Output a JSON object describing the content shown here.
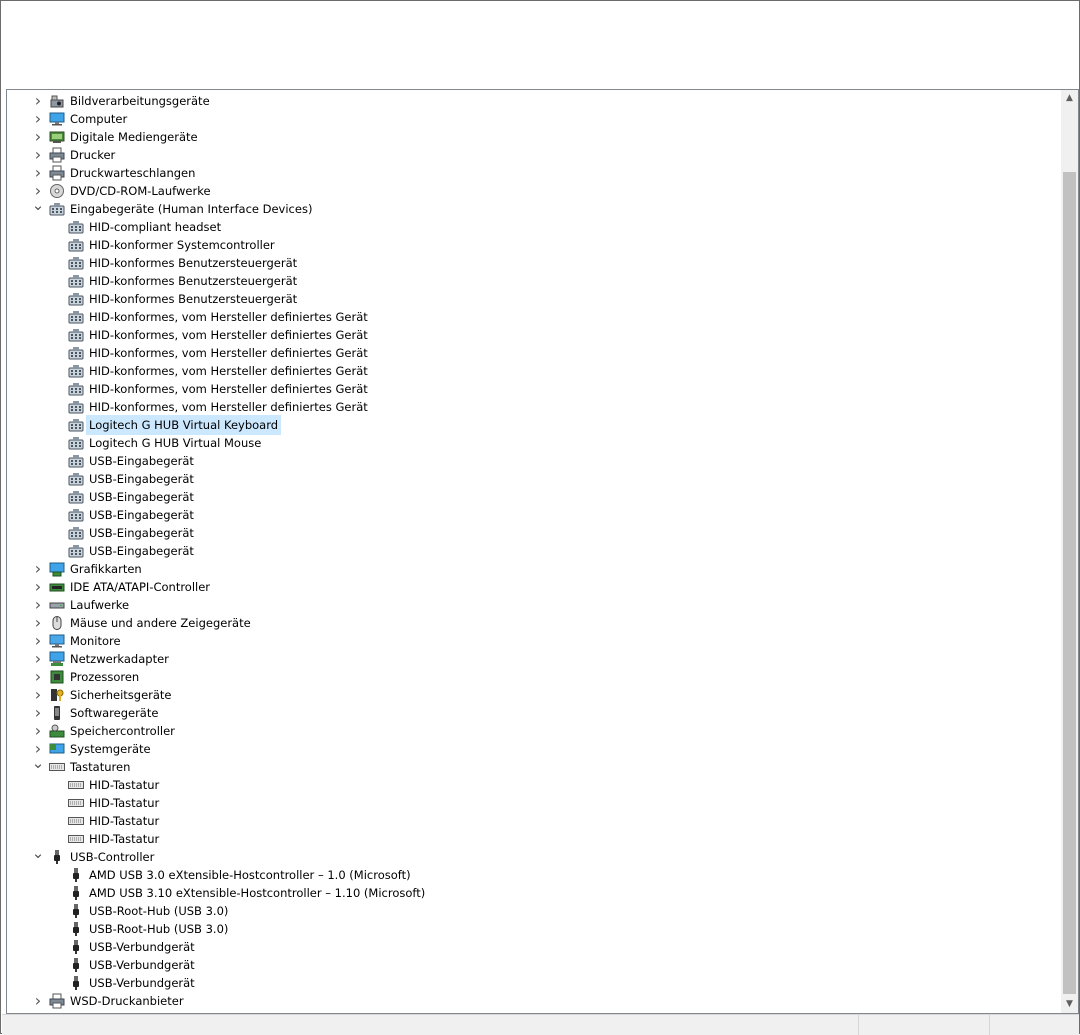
{
  "tree": [
    {
      "label": "Bildverarbeitungsgeräte",
      "level": 0,
      "expander": "collapsed",
      "icon": "camera-scanner-icon"
    },
    {
      "label": "Computer",
      "level": 0,
      "expander": "collapsed",
      "icon": "computer-icon"
    },
    {
      "label": "Digitale Mediengeräte",
      "level": 0,
      "expander": "collapsed",
      "icon": "media-device-icon"
    },
    {
      "label": "Drucker",
      "level": 0,
      "expander": "collapsed",
      "icon": "printer-icon"
    },
    {
      "label": "Druckwarteschlangen",
      "level": 0,
      "expander": "collapsed",
      "icon": "printer-icon"
    },
    {
      "label": "DVD/CD-ROM-Laufwerke",
      "level": 0,
      "expander": "collapsed",
      "icon": "disc-drive-icon"
    },
    {
      "label": "Eingabegeräte (Human Interface Devices)",
      "level": 0,
      "expander": "expanded",
      "icon": "hid-icon"
    },
    {
      "label": "HID-compliant headset",
      "level": 1,
      "icon": "hid-icon"
    },
    {
      "label": "HID-konformer Systemcontroller",
      "level": 1,
      "icon": "hid-icon"
    },
    {
      "label": "HID-konformes Benutzersteuergerät",
      "level": 1,
      "icon": "hid-icon"
    },
    {
      "label": "HID-konformes Benutzersteuergerät",
      "level": 1,
      "icon": "hid-icon"
    },
    {
      "label": "HID-konformes Benutzersteuergerät",
      "level": 1,
      "icon": "hid-icon"
    },
    {
      "label": "HID-konformes, vom Hersteller definiertes Gerät",
      "level": 1,
      "icon": "hid-icon"
    },
    {
      "label": "HID-konformes, vom Hersteller definiertes Gerät",
      "level": 1,
      "icon": "hid-icon"
    },
    {
      "label": "HID-konformes, vom Hersteller definiertes Gerät",
      "level": 1,
      "icon": "hid-icon"
    },
    {
      "label": "HID-konformes, vom Hersteller definiertes Gerät",
      "level": 1,
      "icon": "hid-icon"
    },
    {
      "label": "HID-konformes, vom Hersteller definiertes Gerät",
      "level": 1,
      "icon": "hid-icon"
    },
    {
      "label": "HID-konformes, vom Hersteller definiertes Gerät",
      "level": 1,
      "icon": "hid-icon"
    },
    {
      "label": "Logitech G HUB Virtual Keyboard",
      "level": 1,
      "icon": "hid-icon",
      "selected": true
    },
    {
      "label": "Logitech G HUB Virtual Mouse",
      "level": 1,
      "icon": "hid-icon"
    },
    {
      "label": "USB-Eingabegerät",
      "level": 1,
      "icon": "hid-icon"
    },
    {
      "label": "USB-Eingabegerät",
      "level": 1,
      "icon": "hid-icon"
    },
    {
      "label": "USB-Eingabegerät",
      "level": 1,
      "icon": "hid-icon"
    },
    {
      "label": "USB-Eingabegerät",
      "level": 1,
      "icon": "hid-icon"
    },
    {
      "label": "USB-Eingabegerät",
      "level": 1,
      "icon": "hid-icon"
    },
    {
      "label": "USB-Eingabegerät",
      "level": 1,
      "icon": "hid-icon"
    },
    {
      "label": "Grafikkarten",
      "level": 0,
      "expander": "collapsed",
      "icon": "display-adapter-icon"
    },
    {
      "label": "IDE ATA/ATAPI-Controller",
      "level": 0,
      "expander": "collapsed",
      "icon": "ide-controller-icon"
    },
    {
      "label": "Laufwerke",
      "level": 0,
      "expander": "collapsed",
      "icon": "disk-drive-icon"
    },
    {
      "label": "Mäuse und andere Zeigegeräte",
      "level": 0,
      "expander": "collapsed",
      "icon": "mouse-icon"
    },
    {
      "label": "Monitore",
      "level": 0,
      "expander": "collapsed",
      "icon": "monitor-icon"
    },
    {
      "label": "Netzwerkadapter",
      "level": 0,
      "expander": "collapsed",
      "icon": "network-adapter-icon"
    },
    {
      "label": "Prozessoren",
      "level": 0,
      "expander": "collapsed",
      "icon": "processor-icon"
    },
    {
      "label": "Sicherheitsgeräte",
      "level": 0,
      "expander": "collapsed",
      "icon": "security-device-icon"
    },
    {
      "label": "Softwaregeräte",
      "level": 0,
      "expander": "collapsed",
      "icon": "software-device-icon"
    },
    {
      "label": "Speichercontroller",
      "level": 0,
      "expander": "collapsed",
      "icon": "storage-controller-icon"
    },
    {
      "label": "Systemgeräte",
      "level": 0,
      "expander": "collapsed",
      "icon": "system-device-icon"
    },
    {
      "label": "Tastaturen",
      "level": 0,
      "expander": "expanded",
      "icon": "keyboard-icon"
    },
    {
      "label": "HID-Tastatur",
      "level": 1,
      "icon": "keyboard-icon"
    },
    {
      "label": "HID-Tastatur",
      "level": 1,
      "icon": "keyboard-icon"
    },
    {
      "label": "HID-Tastatur",
      "level": 1,
      "icon": "keyboard-icon"
    },
    {
      "label": "HID-Tastatur",
      "level": 1,
      "icon": "keyboard-icon"
    },
    {
      "label": "USB-Controller",
      "level": 0,
      "expander": "expanded",
      "icon": "usb-icon"
    },
    {
      "label": "AMD USB 3.0 eXtensible-Hostcontroller – 1.0 (Microsoft)",
      "level": 1,
      "icon": "usb-icon"
    },
    {
      "label": "AMD USB 3.10 eXtensible-Hostcontroller – 1.10 (Microsoft)",
      "level": 1,
      "icon": "usb-icon"
    },
    {
      "label": "USB-Root-Hub (USB 3.0)",
      "level": 1,
      "icon": "usb-icon"
    },
    {
      "label": "USB-Root-Hub (USB 3.0)",
      "level": 1,
      "icon": "usb-icon"
    },
    {
      "label": "USB-Verbundgerät",
      "level": 1,
      "icon": "usb-icon"
    },
    {
      "label": "USB-Verbundgerät",
      "level": 1,
      "icon": "usb-icon"
    },
    {
      "label": "USB-Verbundgerät",
      "level": 1,
      "icon": "usb-icon"
    },
    {
      "label": "WSD-Druckanbieter",
      "level": 0,
      "expander": "collapsed",
      "icon": "printer-icon"
    }
  ],
  "colors": {
    "selection": "#cce8ff",
    "scrollbar_track": "#f0f0f0",
    "scrollbar_thumb": "#c1c1c1"
  }
}
